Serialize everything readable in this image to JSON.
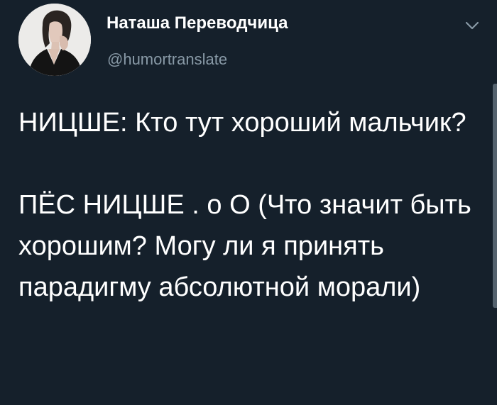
{
  "tweet": {
    "author": {
      "display_name": "Наташа Переводчица",
      "handle": "@humortranslate",
      "avatar_icon": "profile-photo"
    },
    "menu_icon": "chevron-down-icon",
    "text_paragraphs": [
      "НИЦШЕ: Кто тут хороший мальчик?",
      "ПЁС НИЦШЕ . о О (Что значит быть хорошим? Могу ли я принять парадигму абсолютной морали)"
    ]
  },
  "colors": {
    "background": "#15202b",
    "primary_text": "#ffffff",
    "secondary_text": "#8899a6"
  }
}
